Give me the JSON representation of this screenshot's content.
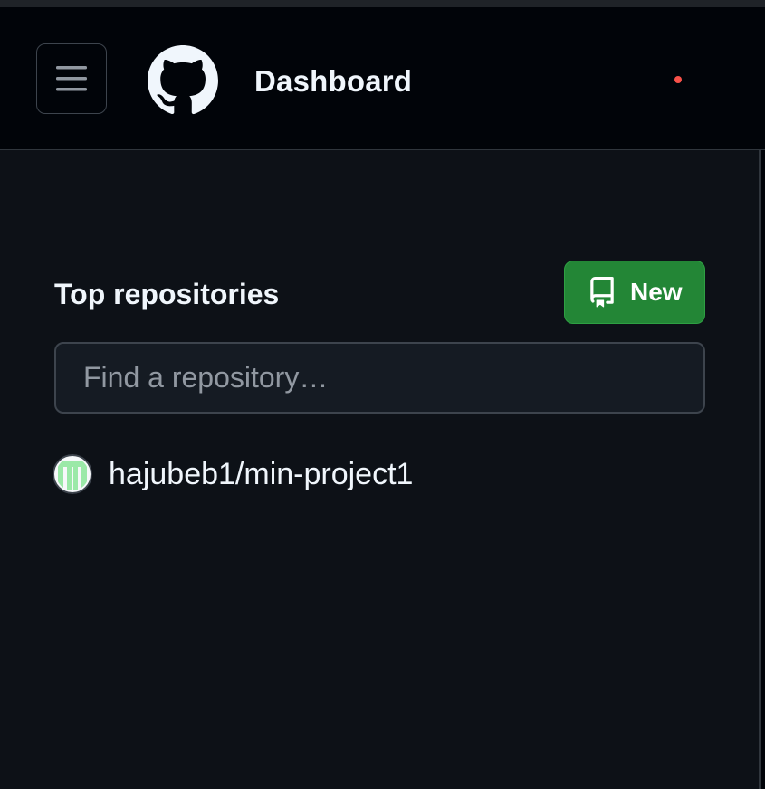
{
  "header": {
    "title": "Dashboard",
    "menu_icon": "hamburger-icon",
    "logo_icon": "github-logo-icon",
    "notification_color": "#f85149"
  },
  "sidebar": {
    "section_title": "Top repositories",
    "new_button": {
      "label": "New",
      "icon": "repo-icon",
      "color": "#238636"
    },
    "search": {
      "placeholder": "Find a repository…",
      "value": ""
    },
    "repositories": [
      {
        "owner": "hajubeb1",
        "name": "min-project1",
        "avatar": "identicon-avatar",
        "avatar_color": "#9be9a8"
      }
    ]
  },
  "colors": {
    "background": "#0d1117",
    "header_background": "#010409",
    "border": "#30363d",
    "text": "#f0f6fc",
    "muted_text": "#9198a1"
  }
}
